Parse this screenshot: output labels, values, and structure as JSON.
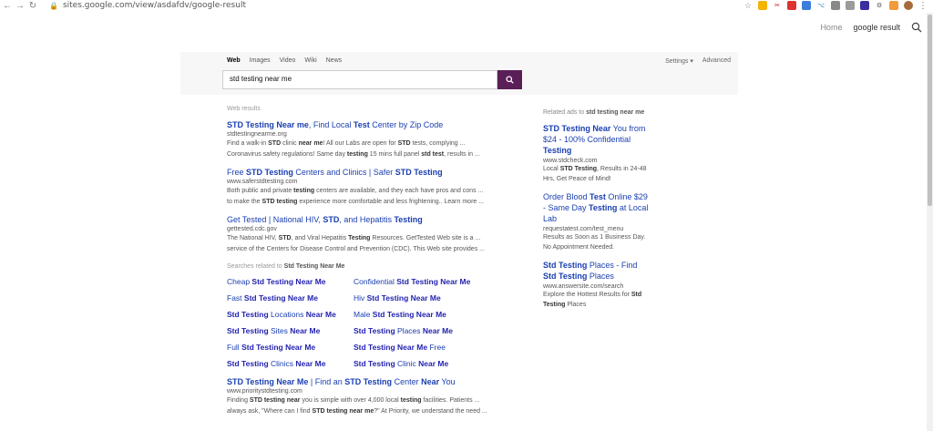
{
  "browser": {
    "url": "sites.google.com/view/asdafdv/google-result"
  },
  "site_nav": {
    "home": "Home",
    "current": "google result"
  },
  "search": {
    "tabs": [
      "Web",
      "Images",
      "Video",
      "Wiki",
      "News"
    ],
    "active_tab": "Web",
    "settings_label": "Settings ▾",
    "advanced_label": "Advanced",
    "query": "std testing near me"
  },
  "results_label": "Web results",
  "results": [
    {
      "title_parts": [
        [
          "STD Testing Near me",
          true
        ],
        [
          ", Find Local ",
          false
        ],
        [
          "Test",
          true
        ],
        [
          " Center by Zip Code",
          false
        ]
      ],
      "url": "stdtestingnearme.org",
      "desc1": [
        [
          "Find a walk-in ",
          false
        ],
        [
          "STD",
          true
        ],
        [
          " clinic ",
          false
        ],
        [
          "near me",
          true
        ],
        [
          "! All our Labs are open for ",
          false
        ],
        [
          "STD",
          true
        ],
        [
          " tests, complying ...",
          false
        ]
      ],
      "desc2": [
        [
          "Coronavirus safety regulations! Same day ",
          false
        ],
        [
          "testing",
          true
        ],
        [
          " 15 mins full panel ",
          false
        ],
        [
          "std test",
          true
        ],
        [
          ", results in ...",
          false
        ]
      ]
    },
    {
      "title_parts": [
        [
          "Free ",
          false
        ],
        [
          "STD Testing",
          true
        ],
        [
          " Centers and Clinics | Safer ",
          false
        ],
        [
          "STD Testing",
          true
        ]
      ],
      "url": "www.saferstdtesting.com",
      "desc1": [
        [
          "Both public and private ",
          false
        ],
        [
          "testing",
          true
        ],
        [
          " centers are available, and they each have pros and cons ...",
          false
        ]
      ],
      "desc2": [
        [
          "to make the ",
          false
        ],
        [
          "STD testing",
          true
        ],
        [
          " experience more comfortable and less frightening.. Learn more ...",
          false
        ]
      ]
    },
    {
      "title_parts": [
        [
          "Get Tested | National HIV, ",
          false
        ],
        [
          "STD",
          true
        ],
        [
          ", and Hepatitis ",
          false
        ],
        [
          "Testing",
          true
        ]
      ],
      "url": "gettested.cdc.gov",
      "desc1": [
        [
          "The National HIV, ",
          false
        ],
        [
          "STD",
          true
        ],
        [
          ", and Viral Hepatitis ",
          false
        ],
        [
          "Testing",
          true
        ],
        [
          " Resources. GetTested Web site is a ...",
          false
        ]
      ],
      "desc2": [
        [
          "service of the Centers for Disease Control and Prevention (CDC). This Web site provides ...",
          false
        ]
      ]
    }
  ],
  "related_label_prefix": "Searches related to ",
  "related_label_query": "Std Testing Near Me",
  "related": [
    [
      [
        "Cheap ",
        false
      ],
      [
        "Std Testing Near Me",
        true
      ]
    ],
    [
      [
        "Confidential ",
        false
      ],
      [
        "Std Testing Near Me",
        true
      ]
    ],
    [
      [
        "Fast ",
        false
      ],
      [
        "Std Testing Near Me",
        true
      ]
    ],
    [
      [
        "Hiv ",
        false
      ],
      [
        "Std Testing Near Me",
        true
      ]
    ],
    [
      [
        "Std Testing",
        true
      ],
      [
        " Locations ",
        false
      ],
      [
        "Near Me",
        true
      ]
    ],
    [
      [
        "Male ",
        false
      ],
      [
        "Std Testing Near Me",
        true
      ]
    ],
    [
      [
        "Std Testing",
        true
      ],
      [
        " Sites ",
        false
      ],
      [
        "Near Me",
        true
      ]
    ],
    [
      [
        "Std Testing",
        true
      ],
      [
        " Places ",
        false
      ],
      [
        "Near Me",
        true
      ]
    ],
    [
      [
        "Full ",
        false
      ],
      [
        "Std Testing Near Me",
        true
      ]
    ],
    [
      [
        "Std Testing Near Me",
        true
      ],
      [
        " Free",
        false
      ]
    ],
    [
      [
        "Std Testing",
        true
      ],
      [
        " Clinics ",
        false
      ],
      [
        "Near Me",
        true
      ]
    ],
    [
      [
        "Std Testing",
        true
      ],
      [
        " Clinic ",
        false
      ],
      [
        "Near Me",
        true
      ]
    ]
  ],
  "last_result": {
    "title_parts": [
      [
        "STD Testing Near Me",
        true
      ],
      [
        " | Find an ",
        false
      ],
      [
        "STD Testing",
        true
      ],
      [
        " Center ",
        false
      ],
      [
        "Near",
        true
      ],
      [
        " You",
        false
      ]
    ],
    "url": "www.prioritystdtesting.com",
    "desc1": [
      [
        "Finding ",
        false
      ],
      [
        "STD testing near",
        true
      ],
      [
        " you is simple with over 4,000 local ",
        false
      ],
      [
        "testing",
        true
      ],
      [
        " facilities. Patients ...",
        false
      ]
    ],
    "desc2": [
      [
        "always ask, \"Where can I find ",
        false
      ],
      [
        "STD testing near me",
        true
      ],
      [
        "?\" At Priority, we understand the need ...",
        false
      ]
    ]
  },
  "ads_label_prefix": "Related ads to ",
  "ads_label_query": "std testing near me",
  "ads": [
    {
      "title_parts": [
        [
          "STD Testing Near",
          true
        ],
        [
          " You from $24 - 100% Confidential ",
          false
        ],
        [
          "Testing",
          true
        ]
      ],
      "url": "www.stdcheck.com",
      "desc": [
        [
          "Local ",
          false
        ],
        [
          "STD Testing",
          true
        ],
        [
          ", Results in 24-48 Hrs, Get Peace of Mind!",
          false
        ]
      ]
    },
    {
      "title_parts": [
        [
          "Order Blood ",
          false
        ],
        [
          "Test",
          true
        ],
        [
          " Online $29 - Same Day ",
          false
        ],
        [
          "Testing",
          true
        ],
        [
          " at Local Lab",
          false
        ]
      ],
      "url": "requestatest.com/test_menu",
      "desc": [
        [
          "Results as Soon as 1 Business Day. No Appointment Needed.",
          false
        ]
      ]
    },
    {
      "title_parts": [
        [
          "Std Testing",
          true
        ],
        [
          " Places - Find ",
          false
        ],
        [
          "Std Testing",
          true
        ],
        [
          " Places",
          false
        ]
      ],
      "url": "www.answersite.com/search",
      "desc": [
        [
          "Explore the Hottest Results for ",
          false
        ],
        [
          "Std Testing",
          true
        ],
        [
          " Places",
          false
        ]
      ]
    }
  ],
  "colors": {
    "accent": "#5b1f58",
    "link": "#1a3fb0"
  }
}
